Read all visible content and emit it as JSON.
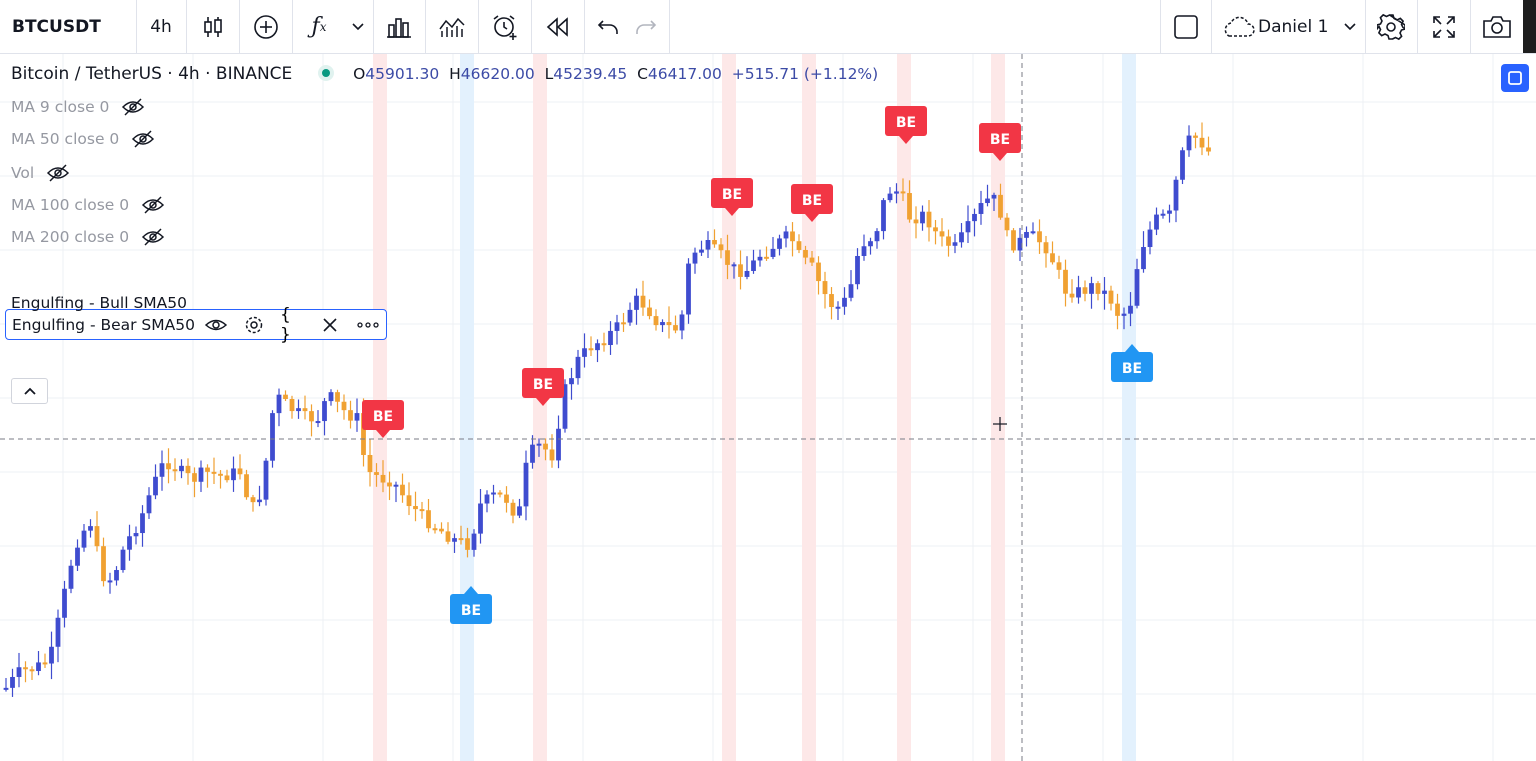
{
  "toolbar": {
    "symbol": "BTCUSDT",
    "interval": "4h",
    "layout_name": "Daniel 1",
    "icons": [
      "candles-icon",
      "add-symbol-icon",
      "indicators-fx-icon",
      "chevron-down-icon",
      "templates-icon",
      "compare-icon",
      "alert-icon",
      "replay-icon",
      "undo-icon",
      "redo-icon",
      "layout-square-icon",
      "cloud-icon",
      "chevron-down-icon",
      "settings-icon",
      "fullscreen-icon",
      "camera-icon"
    ]
  },
  "legend": {
    "title": "Bitcoin / TetherUS · 4h · BINANCE",
    "open_label": "O",
    "open": "45901.30",
    "high_label": "H",
    "high": "46620.00",
    "low_label": "L",
    "low": "45239.45",
    "close_label": "C",
    "close": "46417.00",
    "change": "+515.71 (+1.12%)",
    "status_color": "#089981"
  },
  "indicators": [
    {
      "label": "MA 9 close 0",
      "hidden": true
    },
    {
      "label": "MA 50 close 0",
      "hidden": true
    },
    {
      "label": "Vol",
      "hidden": true
    },
    {
      "label": "MA 100 close 0",
      "hidden": true
    },
    {
      "label": "MA 200 close 0",
      "hidden": true
    },
    {
      "label": "Engulfing - Bear SMA50",
      "hidden": false,
      "selected": true
    },
    {
      "label": "Engulfing - Bull SMA50",
      "hidden": false
    }
  ],
  "chart_data": {
    "type": "candlestick",
    "up_color": "#3f4ccf",
    "down_color": "#f0a132",
    "marker_text": "BE",
    "bear_color": "#f23645",
    "bull_color": "#2196f3",
    "bars": [
      [
        45901.3,
        46620.0,
        45239.45,
        46417.0
      ]
    ]
  }
}
